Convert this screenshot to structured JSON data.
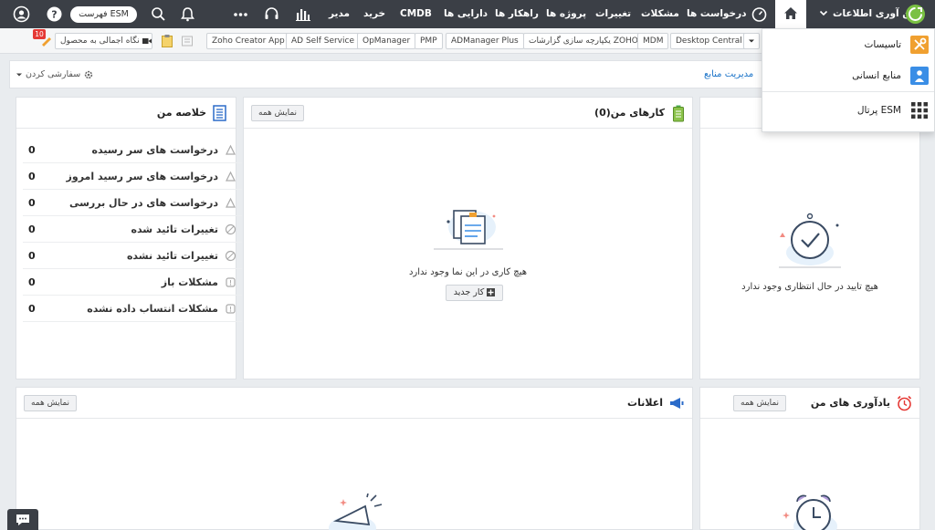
{
  "topbar": {
    "brand": "فن آوری اطلاعات",
    "nav": [
      "درخواست ها",
      "مشکلات",
      "تغییرات",
      "پروژه ها",
      "راهکار ها",
      "دارایی ها",
      "CMDB",
      "خرید",
      "مدیر"
    ],
    "esm_list": "فهرست ESM",
    "icons": [
      "dashboard-icon",
      "reports-icon",
      "headset-icon",
      "more-icon",
      "bell-icon",
      "search-icon",
      "help-icon",
      "user-icon"
    ]
  },
  "toolbar2": {
    "chips": [
      "Desktop Central",
      "MDM",
      "یکپارچه سازی گزارشات ZOHO",
      "ADManager Plus",
      "PMP",
      "OpManager",
      "AD Self Service",
      "Zoho Creator App"
    ],
    "product_overview": "نگاه اجمالی به محصول",
    "badge": "10"
  },
  "module": {
    "customize": "سفارشی کردن",
    "resource_mgmt": "مدیریت منابع"
  },
  "approvals": {
    "empty": "هیچ تایید در حال انتظاری وجود ندارد"
  },
  "tasks": {
    "title": "کارهای من(0)",
    "show_all": "نمایش همه",
    "empty": "هیچ کاری در این نما وجود ندارد",
    "new_task": "کار جدید"
  },
  "summary": {
    "title": "خلاصه من",
    "rows": [
      {
        "label": "درخواست های سر رسیده",
        "value": "0"
      },
      {
        "label": "درخواست های سر رسید امروز",
        "value": "0"
      },
      {
        "label": "درخواست های در حال بررسی",
        "value": "0"
      },
      {
        "label": "تغییرات تائید شده",
        "value": "0"
      },
      {
        "label": "تغییرات تائید نشده",
        "value": "0"
      },
      {
        "label": "مشکلات باز",
        "value": "0"
      },
      {
        "label": "مشکلات انتساب داده نشده",
        "value": "0"
      }
    ]
  },
  "announcements": {
    "title": "اعلانات",
    "show_all": "نمایش همه"
  },
  "reminders": {
    "title": "یادآوری های من",
    "show_all": "نمایش همه"
  },
  "dropdown": {
    "items": [
      "تاسیسات",
      "منابع انسانی",
      "پرتال ESM"
    ]
  },
  "colors": {
    "topbar": "#3b3f46",
    "link": "#1a73c8",
    "brand_green": "#7ac143",
    "accent_blue": "#3a8ee6"
  }
}
